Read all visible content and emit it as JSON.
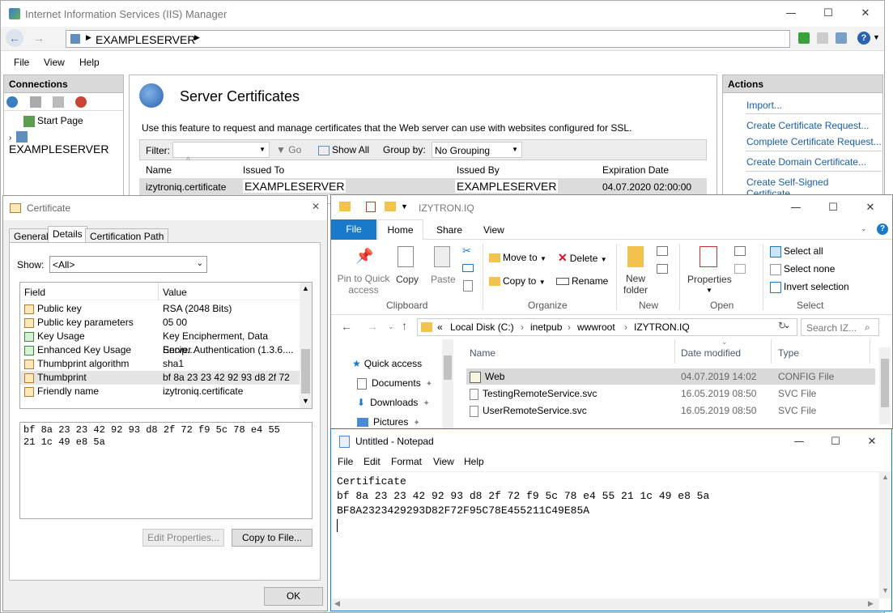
{
  "iis": {
    "title": "Internet Information Services (IIS) Manager",
    "address": "EXAMPLESERVER",
    "menu": [
      "File",
      "View",
      "Help"
    ],
    "connections": {
      "header": "Connections",
      "tree": [
        "Start Page",
        "EXAMPLESERVER"
      ]
    },
    "main": {
      "title": "Server Certificates",
      "description": "Use this feature to request and manage certificates that the Web server can use with websites configured for SSL.",
      "filter_label": "Filter:",
      "go": "Go",
      "show_all": "Show All",
      "group_by": "Group by:",
      "group_value": "No Grouping",
      "columns": [
        "Name",
        "Issued To",
        "Issued By",
        "Expiration Date"
      ],
      "row": [
        "izytroniq.certificate",
        "EXAMPLESERVER",
        "EXAMPLESERVER",
        "04.07.2020 02:00:00"
      ]
    },
    "actions": {
      "header": "Actions",
      "items": [
        "Import...",
        "Create Certificate Request...",
        "Complete Certificate Request...",
        "Create Domain Certificate...",
        "Create Self-Signed Certificate..."
      ]
    }
  },
  "cert": {
    "title": "Certificate",
    "tabs": [
      "General",
      "Details",
      "Certification Path"
    ],
    "show_label": "Show:",
    "show_value": "<All>",
    "columns": [
      "Field",
      "Value"
    ],
    "rows": [
      [
        "Public key",
        "RSA (2048 Bits)"
      ],
      [
        "Public key parameters",
        "05 00"
      ],
      [
        "Key Usage",
        "Key Encipherment, Data Encip..."
      ],
      [
        "Enhanced Key Usage",
        "Server Authentication (1.3.6...."
      ],
      [
        "Thumbprint algorithm",
        "sha1"
      ],
      [
        "Thumbprint",
        "bf 8a 23 23 42 92 93 d8 2f 72 ..."
      ],
      [
        "Friendly name",
        "izytroniq.certificate"
      ]
    ],
    "detail_line1": "bf 8a 23 23 42 92 93 d8 2f 72 f9 5c 78 e4 55",
    "detail_line2": "21 1c 49 e8 5a",
    "edit_btn": "Edit Properties...",
    "copy_btn": "Copy to File...",
    "ok": "OK"
  },
  "explorer": {
    "title": "IZYTRON.IQ",
    "tabs": [
      "File",
      "Home",
      "Share",
      "View"
    ],
    "ribbon": {
      "pin": "Pin to Quick access",
      "copy": "Copy",
      "paste": "Paste",
      "clipboard": "Clipboard",
      "move_to": "Move to",
      "copy_to": "Copy to",
      "delete": "Delete",
      "rename": "Rename",
      "organize": "Organize",
      "new_folder": "New folder",
      "new": "New",
      "properties": "Properties",
      "open": "Open",
      "select_all": "Select all",
      "select_none": "Select none",
      "invert": "Invert selection",
      "select": "Select"
    },
    "path": [
      "«",
      "Local Disk (C:)",
      "inetpub",
      "wwwroot",
      "IZYTRON.IQ"
    ],
    "search": "Search IZ...",
    "nav": [
      "Quick access",
      "Documents",
      "Downloads",
      "Pictures"
    ],
    "columns": [
      "Name",
      "Date modified",
      "Type"
    ],
    "files": [
      [
        "Web",
        "04.07.2019 14:02",
        "CONFIG File"
      ],
      [
        "TestingRemoteService.svc",
        "16.05.2019 08:50",
        "SVC File"
      ],
      [
        "UserRemoteService.svc",
        "16.05.2019 08:50",
        "SVC File"
      ]
    ]
  },
  "notepad": {
    "title": "Untitled - Notepad",
    "menu": [
      "File",
      "Edit",
      "Format",
      "View",
      "Help"
    ],
    "lines": [
      "Certificate",
      "bf 8a 23 23 42 92 93 d8 2f 72 f9 5c 78 e4 55 21 1c 49 e8 5a",
      "BF8A2323429293D82F72F95C78E455211C49E85A"
    ]
  }
}
